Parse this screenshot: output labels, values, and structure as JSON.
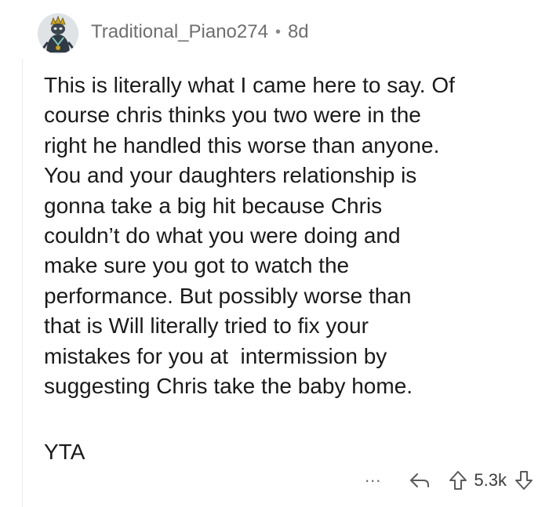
{
  "comment": {
    "username": "Traditional_Piano274",
    "separator": "•",
    "age": "8d",
    "body_lines": [
      "This is literally what I came here to say. Of",
      "course chris thinks you two were in the",
      "right he handled this worse than anyone.",
      "You and your daughters relationship is",
      "gonna take a big hit because Chris",
      "couldn’t do what you were doing and",
      "make sure you got to watch the",
      "performance. But possibly worse than",
      "that is Will literally tried to fix your",
      "mistakes for you at  intermission by",
      "suggesting Chris take the baby home."
    ],
    "verdict": "YTA"
  },
  "actions": {
    "more_label": "...",
    "score": "5.3k",
    "icons": {
      "more": "more-options-icon",
      "reply": "reply-arrow-icon",
      "upvote": "upvote-arrow-icon",
      "downvote": "downvote-arrow-icon"
    }
  },
  "colors": {
    "text": "#1a1a1b",
    "meta": "#6f6f6f",
    "icon": "#5a5a5a",
    "thread_line": "#ececec"
  }
}
